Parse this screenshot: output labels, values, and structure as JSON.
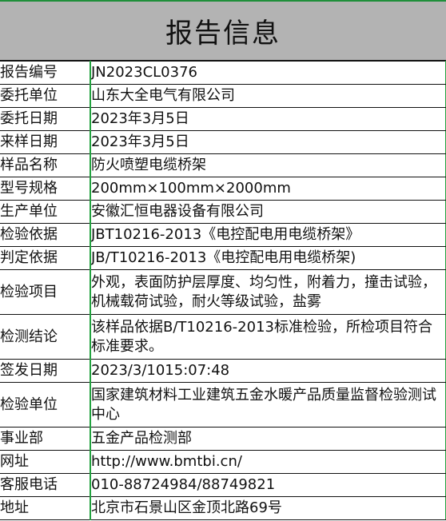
{
  "title": "报告信息",
  "rows": [
    {
      "label": "报告编号",
      "value": "JN2023CL0376"
    },
    {
      "label": "委托单位",
      "value": "山东大全电气有限公司"
    },
    {
      "label": "委托日期",
      "value": "2023年3月5日"
    },
    {
      "label": "来样日期",
      "value": "2023年3月5日"
    },
    {
      "label": "样品名称",
      "value": "防火喷塑电缆桥架"
    },
    {
      "label": "型号规格",
      "value": "200mm×100mm×2000mm"
    },
    {
      "label": "生产单位",
      "value": "安徽汇恒电器设备有限公司"
    },
    {
      "label": "检验依据",
      "value": "JBT10216-2013《电控配电用电缆桥架》"
    },
    {
      "label": "判定依据",
      "value": "JB/T10216-2013《电控配电用电缆桥架)"
    },
    {
      "label": "检验项目",
      "value": "外观，表面防护层厚度、均匀性，附着力，撞击试验，机械载荷试验，耐火等级试验，盐雾"
    },
    {
      "label": "检测结论",
      "value": "该样品依据B/T10216-2013标准检验，所检项目符合标准要求。"
    },
    {
      "label": "签发日期",
      "value": "2023/3/1015:07:48"
    },
    {
      "label": "检验单位",
      "value": "国家建筑材料工业建筑五金水暖产品质量监督检验测试中心"
    },
    {
      "label": "事业部",
      "value": "五金产品检测部"
    },
    {
      "label": "网址",
      "value": "http://www.bmtbi.cn/"
    },
    {
      "label": "客服电话",
      "value": "010-88724984/88749821"
    },
    {
      "label": "地址",
      "value": "北京市石景山区金顶北路69号"
    }
  ]
}
